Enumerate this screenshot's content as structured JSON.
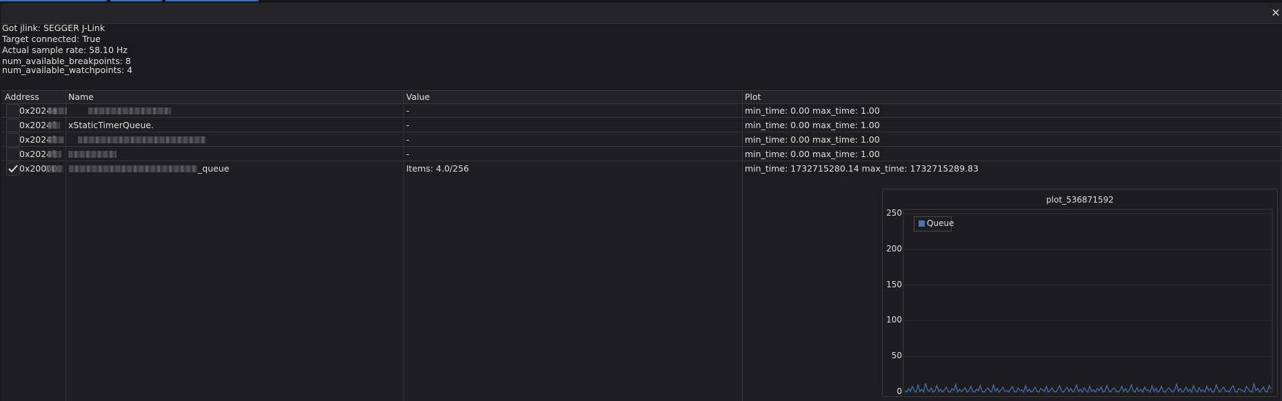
{
  "window": {
    "close_icon": "close-icon"
  },
  "info": {
    "line1": "Got jlink: SEGGER J-Link",
    "line2": "Target connected: True",
    "line3": "Actual sample rate: 58.10 Hz",
    "line4": "num_available_breakpoints: 8",
    "line5": "num_available_watchpoints: 4"
  },
  "table": {
    "headers": {
      "address": "Address",
      "name": "Name",
      "value": "Value",
      "plot": "Plot"
    },
    "rows": [
      {
        "checked": false,
        "address": "0x2024e",
        "name": "",
        "value": "-",
        "plot": "min_time: 0.00 max_time: 1.00"
      },
      {
        "checked": false,
        "address": "0x2024f",
        "name": "xStaticTimerQueue.",
        "value": "-",
        "plot": "min_time: 0.00 max_time: 1.00"
      },
      {
        "checked": false,
        "address": "0x2024f",
        "name": "",
        "value": "-",
        "plot": "min_time: 0.00 max_time: 1.00"
      },
      {
        "checked": false,
        "address": "0x2024f",
        "name": "",
        "value": "-",
        "plot": "min_time: 0.00 max_time: 1.00"
      },
      {
        "checked": true,
        "address": "0x20000",
        "name": "_queue",
        "value": "Items: 4.0/256",
        "plot": "min_time: 1732715280.14 max_time: 1732715289.83"
      }
    ]
  },
  "chart_data": {
    "type": "line",
    "title": "plot_536871592",
    "legend": "top-left",
    "series": [
      {
        "name": "Queue",
        "color": "#4c73b4",
        "values": [
          2,
          0,
          5,
          1,
          8,
          2,
          0,
          10,
          1,
          4,
          0,
          12,
          3,
          1,
          6,
          0,
          2,
          9,
          1,
          4,
          0,
          3,
          7,
          1,
          0,
          5,
          2,
          11,
          0,
          4,
          1,
          3,
          6,
          0,
          2,
          8,
          1,
          0,
          4,
          2,
          9,
          1,
          0,
          3,
          6,
          2,
          0,
          10,
          1,
          5,
          0,
          3,
          7,
          1,
          2,
          0,
          4,
          8,
          1,
          0,
          6,
          2,
          3,
          0,
          9,
          1,
          4,
          0,
          2,
          7,
          1,
          0,
          5,
          3,
          1,
          8,
          0,
          2,
          6,
          1,
          0,
          4,
          9,
          2,
          0,
          3,
          7,
          1,
          5,
          0,
          2,
          10,
          1,
          4,
          0,
          6,
          2,
          0,
          8,
          1,
          3,
          0,
          5,
          2,
          7,
          0,
          1,
          9,
          3,
          0,
          4,
          6,
          1,
          0,
          2,
          8,
          1,
          5,
          0,
          3,
          10,
          2,
          0,
          6,
          1,
          4,
          0,
          7,
          2,
          3,
          0,
          9,
          1,
          5,
          0,
          2,
          8,
          1,
          0,
          4,
          6,
          2,
          0,
          3,
          11,
          1,
          5,
          0,
          2,
          7,
          1,
          4,
          0,
          9,
          2,
          0,
          6,
          1,
          3,
          0,
          8,
          2,
          5,
          0,
          1,
          10,
          3,
          0,
          4,
          7,
          1,
          2,
          0,
          6,
          9,
          1,
          0,
          5,
          3,
          2,
          0,
          8,
          4,
          1,
          0,
          12,
          2,
          5,
          0,
          3,
          7,
          1,
          0,
          9,
          4
        ]
      }
    ],
    "ylim": [
      0,
      256
    ],
    "yticks": [
      "250",
      "200",
      "150",
      "100",
      "50",
      "0"
    ]
  }
}
